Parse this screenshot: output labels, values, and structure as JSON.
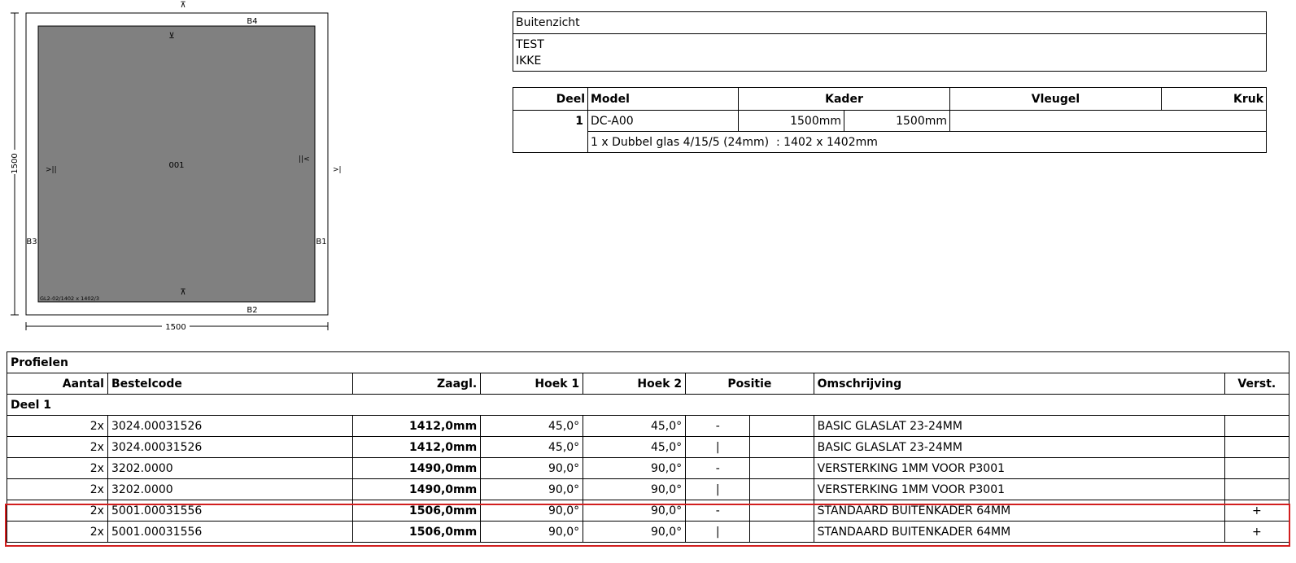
{
  "drawing": {
    "top_mark": "⊼",
    "side_labels": {
      "b1": "B1",
      "b2": "B2",
      "b3": "B3",
      "b4": "B4"
    },
    "width_dim": "1500",
    "height_dim": "1500",
    "panel_label": "001",
    "glass_code": "GL2-02/1402 x 1402/3",
    "hinge_left": ">||",
    "hinge_right": "||<",
    "outer_right_mark": ">|",
    "panel_top_mark": "⊻",
    "panel_bottom_mark": "⊼",
    "panel_fill_color": "#808080"
  },
  "view": {
    "title": "Buitenzicht",
    "lines": [
      "TEST",
      "IKKE"
    ]
  },
  "parts": {
    "headers": {
      "deel": "Deel",
      "model": "Model",
      "kader": "Kader",
      "vleugel": "Vleugel",
      "kruk": "Kruk"
    },
    "row": {
      "deel": "1",
      "model": "DC-A00",
      "kader_w": "1500mm",
      "kader_h": "1500mm"
    },
    "glass_line": "1 x Dubbel glas 4/15/5 (24mm)  : 1402 x 1402mm"
  },
  "profielen": {
    "title": "Profielen",
    "headers": {
      "aantal": "Aantal",
      "bestelcode": "Bestelcode",
      "zaagl": "Zaagl.",
      "hoek1": "Hoek 1",
      "hoek2": "Hoek 2",
      "positie": "Positie",
      "omschrijving": "Omschrijving",
      "verst": "Verst."
    },
    "group": "Deel 1",
    "rows": [
      {
        "aantal": "2x",
        "bestelcode": "3024.00031526",
        "zaagl": "1412,0mm",
        "hoek1": "45,0°",
        "hoek2": "45,0°",
        "positie": "-",
        "omschrijving": "BASIC GLASLAT 23-24MM",
        "verst": ""
      },
      {
        "aantal": "2x",
        "bestelcode": "3024.00031526",
        "zaagl": "1412,0mm",
        "hoek1": "45,0°",
        "hoek2": "45,0°",
        "positie": "|",
        "omschrijving": "BASIC GLASLAT 23-24MM",
        "verst": ""
      },
      {
        "aantal": "2x",
        "bestelcode": "3202.0000",
        "zaagl": "1490,0mm",
        "hoek1": "90,0°",
        "hoek2": "90,0°",
        "positie": "-",
        "omschrijving": "VERSTERKING 1MM VOOR P3001",
        "verst": ""
      },
      {
        "aantal": "2x",
        "bestelcode": "3202.0000",
        "zaagl": "1490,0mm",
        "hoek1": "90,0°",
        "hoek2": "90,0°",
        "positie": "|",
        "omschrijving": "VERSTERKING 1MM VOOR P3001",
        "verst": ""
      },
      {
        "aantal": "2x",
        "bestelcode": "5001.00031556",
        "zaagl": "1506,0mm",
        "hoek1": "90,0°",
        "hoek2": "90,0°",
        "positie": "-",
        "omschrijving": "STANDAARD BUITENKADER 64MM",
        "verst": "+"
      },
      {
        "aantal": "2x",
        "bestelcode": "5001.00031556",
        "zaagl": "1506,0mm",
        "hoek1": "90,0°",
        "hoek2": "90,0°",
        "positie": "|",
        "omschrijving": "STANDAARD BUITENKADER 64MM",
        "verst": "+"
      }
    ],
    "highlight_color": "#d21f1f"
  }
}
